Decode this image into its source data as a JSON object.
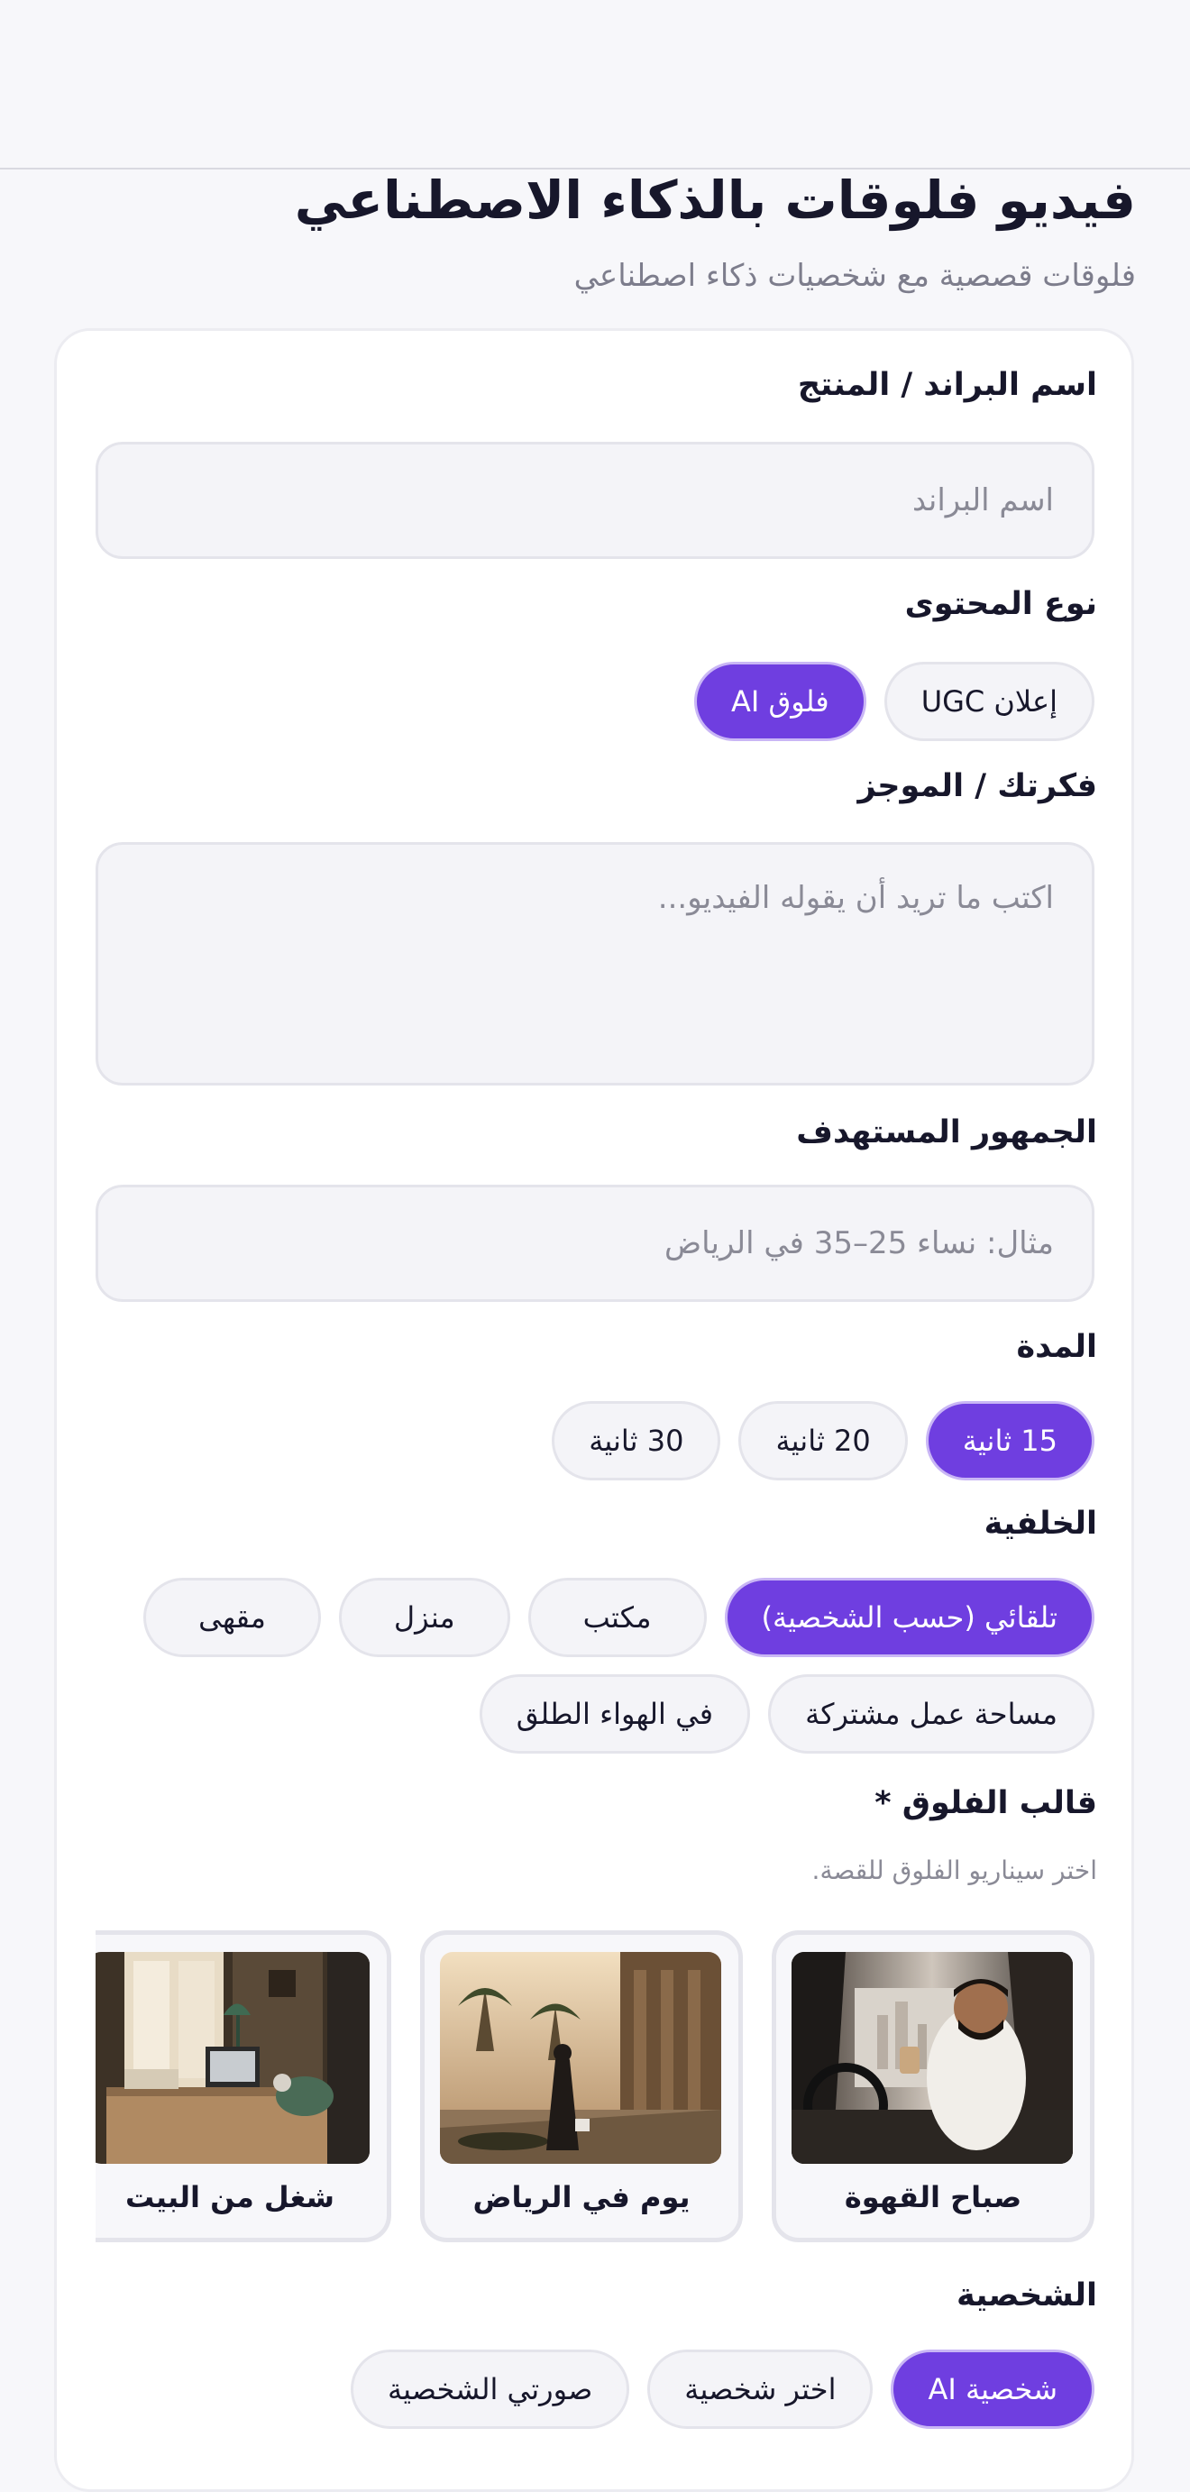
{
  "header": {
    "title": "فيديو فلوقات بالذكاء الاصطناعي",
    "subtitle": "فلوقات قصصية مع شخصيات ذكاء اصطناعي"
  },
  "form": {
    "brand": {
      "label": "اسم البراند / المنتج",
      "placeholder": "اسم البراند",
      "value": ""
    },
    "content_type": {
      "label": "نوع المحتوى",
      "options": [
        "إعلان UGC",
        "فلوق AI"
      ],
      "selected": "فلوق AI"
    },
    "brief": {
      "label": "فكرتك / الموجز",
      "placeholder": "اكتب ما تريد أن يقوله الفيديو...",
      "value": ""
    },
    "audience": {
      "label": "الجمهور المستهدف",
      "placeholder": "مثال: نساء 25–35 في الرياض",
      "value": ""
    },
    "duration": {
      "label": "المدة",
      "options": [
        "15 ثانية",
        "20 ثانية",
        "30 ثانية"
      ],
      "selected": "15 ثانية"
    },
    "background": {
      "label": "الخلفية",
      "options": [
        "تلقائي (حسب الشخصية)",
        "مكتب",
        "منزل",
        "مقهى",
        "مساحة عمل مشتركة",
        "في الهواء الطلق"
      ],
      "selected": "تلقائي (حسب الشخصية)"
    },
    "template": {
      "label": "قالب الفلوق *",
      "hint": "اختر سيناريو الفلوق للقصة.",
      "items": [
        {
          "name": "صباح القهوة",
          "icon": "coffee-morning-photo"
        },
        {
          "name": "يوم في الرياض",
          "icon": "riyadh-day-photo"
        },
        {
          "name": "شغل من البيت",
          "icon": "work-from-home-photo"
        }
      ]
    },
    "persona": {
      "label": "الشخصية",
      "options": [
        "شخصية AI",
        "اختر شخصية",
        "صورتي الشخصية"
      ],
      "selected": "شخصية AI"
    }
  },
  "colors": {
    "accent": "#6f3ee0",
    "field_bg": "#f4f4f8",
    "border": "#e4e4eb"
  }
}
